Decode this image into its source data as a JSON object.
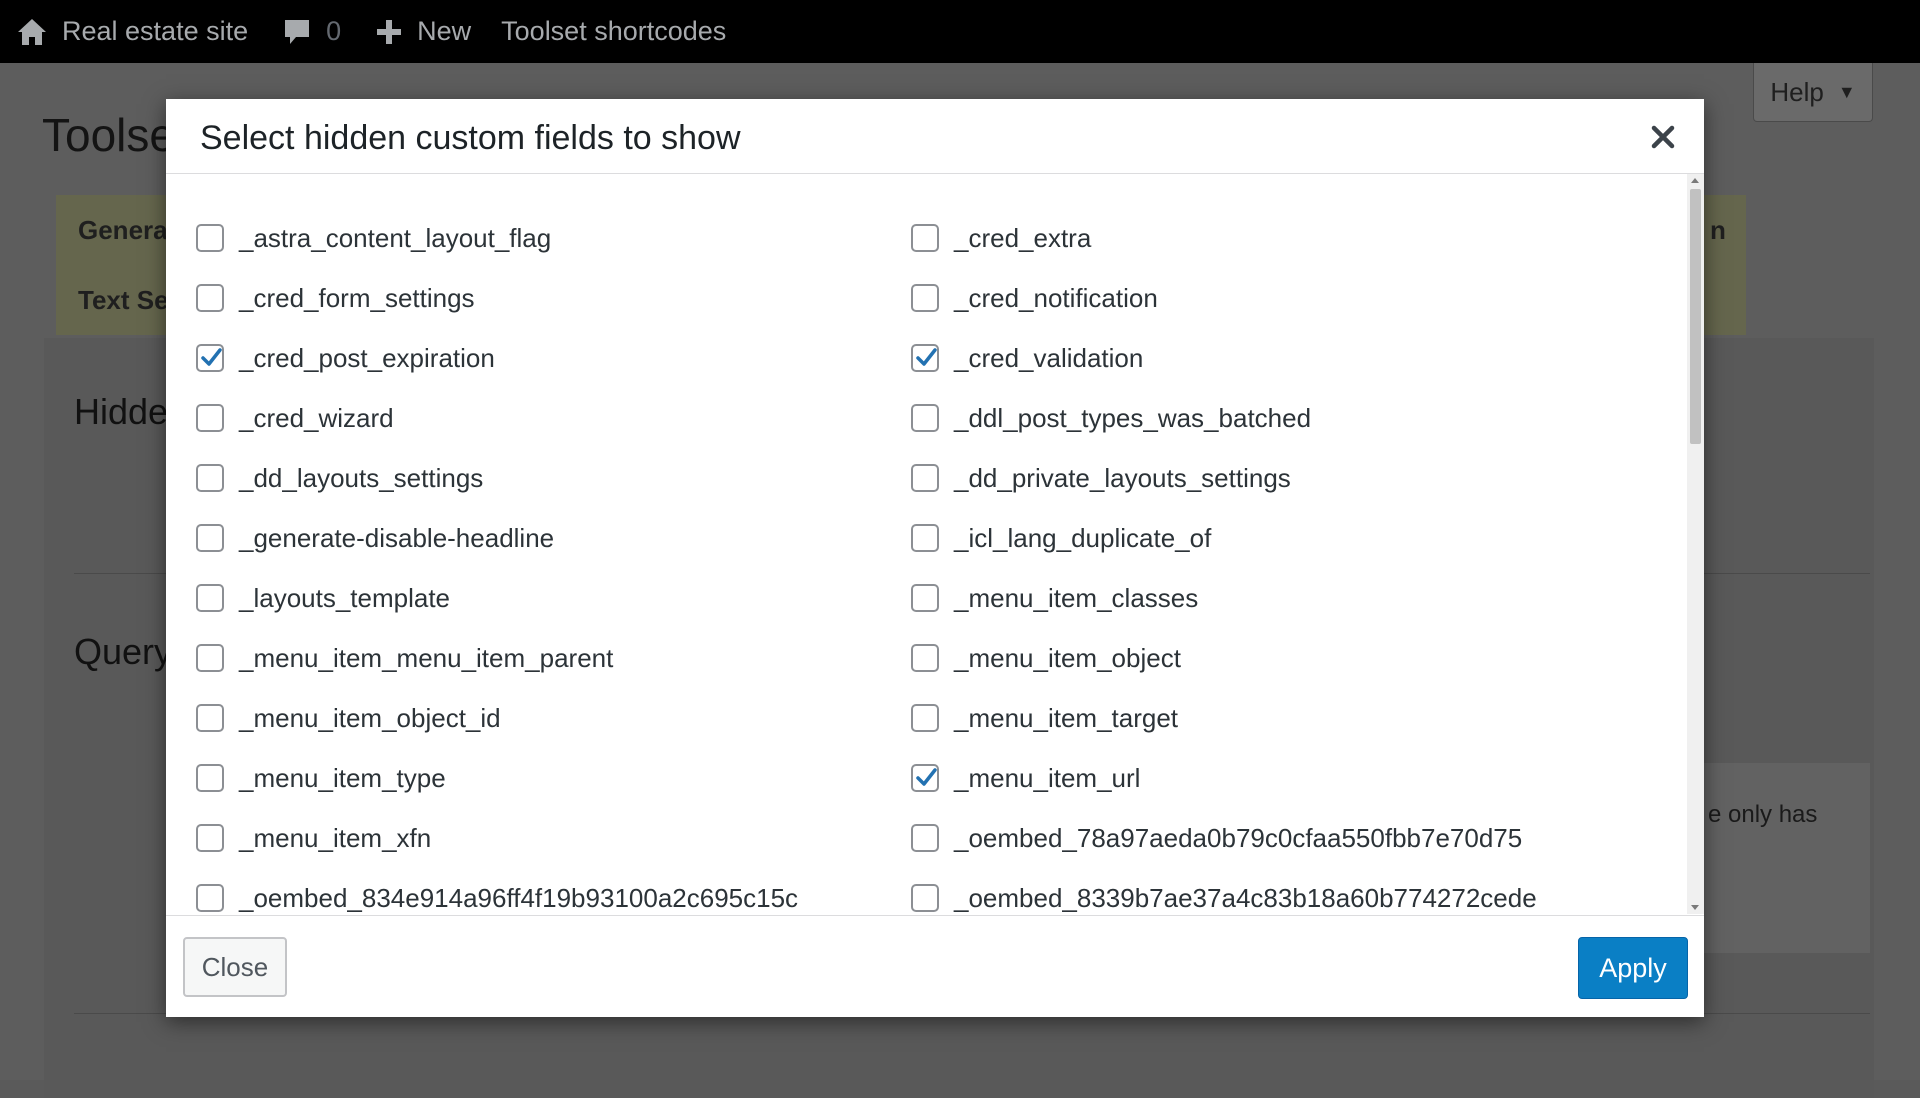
{
  "admin_bar": {
    "site_name": "Real estate site",
    "comments_count": "0",
    "new_label": "New",
    "shortcodes_label": "Toolset shortcodes"
  },
  "background": {
    "page_title": "Toolse",
    "help_label": "Help",
    "tab_1": "Genera",
    "tab_2": "Text Se",
    "tab_right_fragment": "n",
    "heading_1": "Hidde",
    "heading_2": "Query",
    "text_fragment": "e only has"
  },
  "modal": {
    "title": "Select hidden custom fields to show",
    "close_button": "Close",
    "apply_button": "Apply",
    "fields": [
      {
        "label": "_astra_content_layout_flag",
        "checked": false
      },
      {
        "label": "_cred_extra",
        "checked": false
      },
      {
        "label": "_cred_form_settings",
        "checked": false
      },
      {
        "label": "_cred_notification",
        "checked": false
      },
      {
        "label": "_cred_post_expiration",
        "checked": true
      },
      {
        "label": "_cred_validation",
        "checked": true
      },
      {
        "label": "_cred_wizard",
        "checked": false
      },
      {
        "label": "_ddl_post_types_was_batched",
        "checked": false
      },
      {
        "label": "_dd_layouts_settings",
        "checked": false
      },
      {
        "label": "_dd_private_layouts_settings",
        "checked": false
      },
      {
        "label": "_generate-disable-headline",
        "checked": false
      },
      {
        "label": "_icl_lang_duplicate_of",
        "checked": false
      },
      {
        "label": "_layouts_template",
        "checked": false
      },
      {
        "label": "_menu_item_classes",
        "checked": false
      },
      {
        "label": "_menu_item_menu_item_parent",
        "checked": false
      },
      {
        "label": "_menu_item_object",
        "checked": false
      },
      {
        "label": "_menu_item_object_id",
        "checked": false
      },
      {
        "label": "_menu_item_target",
        "checked": false
      },
      {
        "label": "_menu_item_type",
        "checked": false
      },
      {
        "label": "_menu_item_url",
        "checked": true
      },
      {
        "label": "_menu_item_xfn",
        "checked": false
      },
      {
        "label": "_oembed_78a97aeda0b79c0cfaa550fbb7e70d75",
        "checked": false
      },
      {
        "label": "_oembed_834e914a96ff4f19b93100a2c695c15c",
        "checked": false
      },
      {
        "label": "_oembed_8339b7ae37a4c83b18a60b774272cede",
        "checked": false
      }
    ]
  },
  "colors": {
    "admin_bar": "#000000",
    "accent": "#0a7fc5",
    "checkmark": "#2271b1"
  }
}
